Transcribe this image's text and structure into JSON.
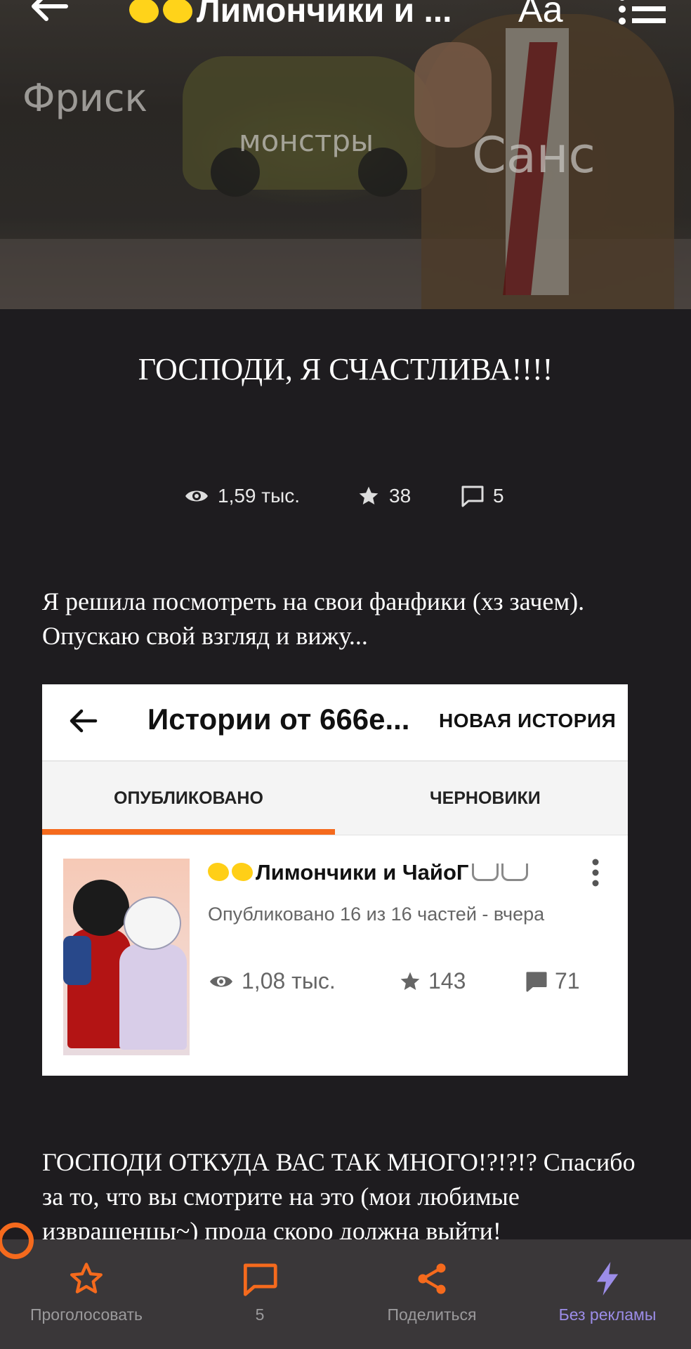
{
  "header": {
    "title": "Лимончики и ...",
    "font_button": "Aa",
    "overlay_labels": [
      "Фриск",
      "монстры",
      "Санс"
    ]
  },
  "post": {
    "title": "ГОСПОДИ, Я СЧАСТЛИВА!!!!",
    "stats": {
      "views": "1,59 тыс.",
      "stars": "38",
      "comments": "5"
    },
    "paragraph1": "Я решила посмотреть на свои фанфики (хз зачем). Опускаю свой взгляд и вижу...",
    "paragraph2": "ГОСПОДИ ОТКУДА ВАС ТАК МНОГО!?!?!? Спасибо за то, что вы смотрите на это (мои любимые извращенцы~) прода скоро должна выйти!"
  },
  "embedded": {
    "title": "Истории от 666e...",
    "new_story": "НОВАЯ ИСТОРИЯ",
    "tabs": [
      "ОПУБЛИКОВАНО",
      "ЧЕРНОВИКИ"
    ],
    "story": {
      "name": "Лимончики и ЧайоГ",
      "meta": "Опубликовано 16 из 16 частей - вчера",
      "views": "1,08 тыс.",
      "stars": "143",
      "comments": "71"
    }
  },
  "bottom_nav": {
    "vote": "Проголосовать",
    "comments": "5",
    "share": "Поделиться",
    "no_ads": "Без рекламы"
  },
  "colors": {
    "accent": "#f56a1d",
    "premium": "#9c8de8",
    "background": "#1e1c1f",
    "bar": "#3a3739"
  }
}
